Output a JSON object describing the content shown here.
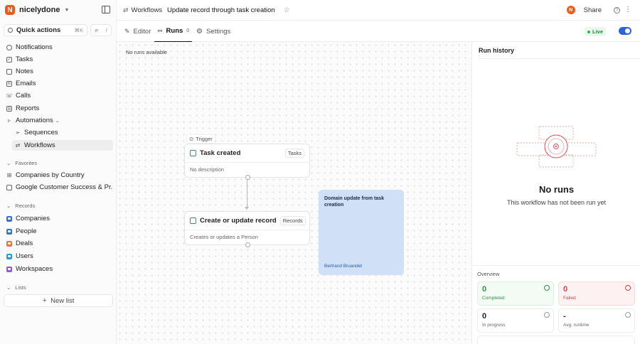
{
  "workspace": {
    "name": "nicelydone",
    "logo_letter": "N"
  },
  "sidebar": {
    "quick_actions": "Quick actions",
    "quick_actions_kbd": "⌘K",
    "search_kbd": "/",
    "items": [
      {
        "label": "Notifications",
        "icon": "bell-icon"
      },
      {
        "label": "Tasks",
        "icon": "checkbox-icon"
      },
      {
        "label": "Notes",
        "icon": "note-icon"
      },
      {
        "label": "Emails",
        "icon": "mail-icon"
      },
      {
        "label": "Calls",
        "icon": "phone-icon"
      },
      {
        "label": "Reports",
        "icon": "chart-icon"
      },
      {
        "label": "Automations",
        "icon": "bolt-icon"
      }
    ],
    "automation_children": [
      {
        "label": "Sequences",
        "icon": "send-icon"
      },
      {
        "label": "Workflows",
        "icon": "workflow-icon",
        "active": true
      }
    ],
    "favorites_header": "Favorites",
    "favorites": [
      {
        "label": "Companies by Country"
      },
      {
        "label": "Google Customer Success & Pr..."
      }
    ],
    "records_header": "Records",
    "records": [
      {
        "label": "Companies",
        "color": "#3b6fd6"
      },
      {
        "label": "People",
        "color": "#3b6fd6"
      },
      {
        "label": "Deals",
        "color": "#e8773a"
      },
      {
        "label": "Users",
        "color": "#2b9ad6"
      },
      {
        "label": "Workspaces",
        "color": "#8a5cd8"
      }
    ],
    "lists_header": "Lists",
    "new_list": "New list"
  },
  "topbar": {
    "crumb_parent": "Workflows",
    "crumb_current": "Update record through task creation",
    "share": "Share",
    "avatar_letter": "N"
  },
  "tabs": [
    {
      "label": "Editor"
    },
    {
      "label": "Runs",
      "count": "0"
    },
    {
      "label": "Settings"
    }
  ],
  "status": {
    "live_label": "Live"
  },
  "canvas": {
    "no_runs": "No runs available",
    "trigger_label": "Trigger",
    "trigger_node": {
      "title": "Task created",
      "tag": "Tasks",
      "description": "No description"
    },
    "action_node": {
      "title": "Create or update record",
      "tag": "Records",
      "description": "Creates or updates a Person"
    },
    "note": {
      "text": "Domain update from task creation",
      "author": "Bertrand Bruandet"
    }
  },
  "run_history": {
    "title": "Run history",
    "empty_title": "No runs",
    "empty_sub": "This workflow has not been run yet",
    "overview_header": "Overview",
    "stats": [
      {
        "value": "0",
        "label": "Completed"
      },
      {
        "value": "0",
        "label": "Failed"
      },
      {
        "value": "0",
        "label": "In progress"
      },
      {
        "value": "-",
        "label": "Avg. runtime"
      }
    ]
  }
}
